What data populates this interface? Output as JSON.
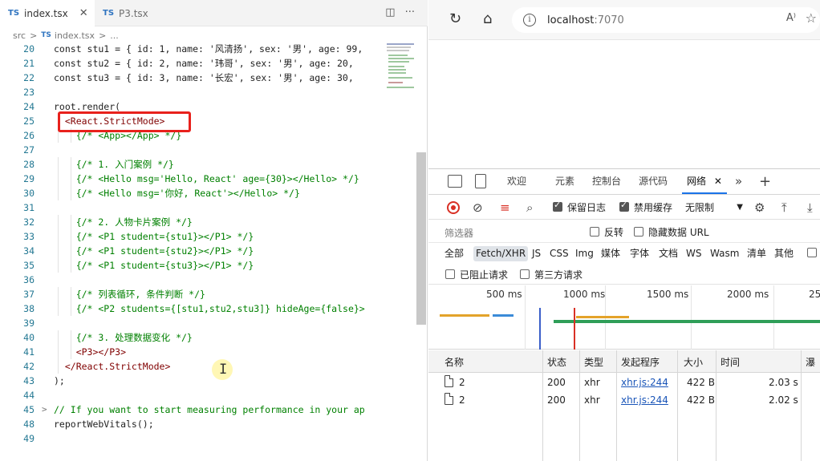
{
  "editor": {
    "tabs": [
      {
        "lang": "TS",
        "label": "index.tsx",
        "close": "✕"
      },
      {
        "lang": "TS",
        "label": "P3.tsx"
      }
    ],
    "actions": {
      "split": "◫",
      "more": "···"
    },
    "breadcrumb": {
      "folder": "src",
      "sep": ">",
      "lang": "TS",
      "file": "index.tsx",
      "tail": "..."
    },
    "lines": [
      {
        "n": "20",
        "t": "const stu1 = { id: 1, name: '风清扬', sex: '男', age: 99, ",
        "k": ""
      },
      {
        "n": "21",
        "t": "const stu2 = { id: 2, name: '玮哥', sex: '男', age: 20, ",
        "k": ""
      },
      {
        "n": "22",
        "t": "const stu3 = { id: 3, name: '长宏', sex: '男', age: 30, ",
        "k": ""
      },
      {
        "n": "23",
        "t": "",
        "k": ""
      },
      {
        "n": "24",
        "t": "root.render(",
        "k": ""
      },
      {
        "n": "25",
        "t": "  <React.StrictMode>",
        "k": "tag"
      },
      {
        "n": "26",
        "t": "    {/* <App></App> */}",
        "k": "comment"
      },
      {
        "n": "27",
        "t": "",
        "k": ""
      },
      {
        "n": "28",
        "t": "    {/* 1. 入门案例 */}",
        "k": "comment"
      },
      {
        "n": "29",
        "t": "    {/* <Hello msg='Hello, React' age={30}></Hello> */}",
        "k": "comment"
      },
      {
        "n": "30",
        "t": "    {/* <Hello msg='你好, React'></Hello> */}",
        "k": "comment"
      },
      {
        "n": "31",
        "t": "",
        "k": ""
      },
      {
        "n": "32",
        "t": "    {/* 2. 人物卡片案例 */}",
        "k": "comment"
      },
      {
        "n": "33",
        "t": "    {/* <P1 student={stu1}></P1> */}",
        "k": "comment"
      },
      {
        "n": "34",
        "t": "    {/* <P1 student={stu2}></P1> */}",
        "k": "comment"
      },
      {
        "n": "35",
        "t": "    {/* <P1 student={stu3}></P1> */}",
        "k": "comment"
      },
      {
        "n": "36",
        "t": "",
        "k": ""
      },
      {
        "n": "37",
        "t": "    {/* 列表循环, 条件判断 */}",
        "k": "comment"
      },
      {
        "n": "38",
        "t": "    {/* <P2 students={[stu1,stu2,stu3]} hideAge={false}>",
        "k": "comment"
      },
      {
        "n": "39",
        "t": "",
        "k": ""
      },
      {
        "n": "40",
        "t": "    {/* 3. 处理数据变化 */}",
        "k": "comment"
      },
      {
        "n": "41",
        "t": "    <P3></P3>",
        "k": "tag"
      },
      {
        "n": "42",
        "t": "  </React.StrictMode>",
        "k": "tag"
      },
      {
        "n": "43",
        "t": ");",
        "k": ""
      },
      {
        "n": "44",
        "t": "",
        "k": ""
      },
      {
        "n": "45",
        "t": "// If you want to start measuring performance in your ap",
        "k": "comment",
        "fold": ">"
      },
      {
        "n": "48",
        "t": "reportWebVitals();",
        "k": ""
      },
      {
        "n": "49",
        "t": "",
        "k": ""
      }
    ]
  },
  "browser": {
    "reload_icon": "↻",
    "home_icon": "⌂",
    "info_icon": "i",
    "url_host": "localhost",
    "url_port": ":7070",
    "read_aloud": "A⁾",
    "favorites_icon": "☆"
  },
  "devtools": {
    "tabs": [
      "欢迎",
      "元素",
      "控制台",
      "源代码",
      "网络",
      "»",
      "+"
    ],
    "network_close": "✕",
    "toolbar": {
      "preserve_log": "保留日志",
      "disable_cache": "禁用缓存",
      "throttle": "无限制",
      "throttle_caret": "▼"
    },
    "filter_placeholder": "筛选器",
    "invert": "反转",
    "hide_data_urls": "隐藏数据 URL",
    "types": [
      "全部",
      "Fetch/XHR",
      "JS",
      "CSS",
      "Img",
      "媒体",
      "字体",
      "文档",
      "WS",
      "Wasm",
      "清单",
      "其他"
    ],
    "blocked_requests": "已阻止请求",
    "third_party": "第三方请求",
    "timeline_ticks": [
      "500 ms",
      "1000 ms",
      "1500 ms",
      "2000 ms",
      "25"
    ],
    "columns": [
      "名称",
      "状态",
      "类型",
      "发起程序",
      "大小",
      "时间",
      "瀑"
    ],
    "rows": [
      {
        "name": "2",
        "status": "200",
        "type": "xhr",
        "initiator": "xhr.js:244",
        "size": "422 B",
        "time": "2.03 s"
      },
      {
        "name": "2",
        "status": "200",
        "type": "xhr",
        "initiator": "xhr.js:244",
        "size": "422 B",
        "time": "2.02 s"
      }
    ]
  },
  "colors": {
    "highlight": "#e8211c",
    "comment": "#008000",
    "tag": "#800000",
    "record": "#d93025",
    "link": "#1a55b8"
  }
}
